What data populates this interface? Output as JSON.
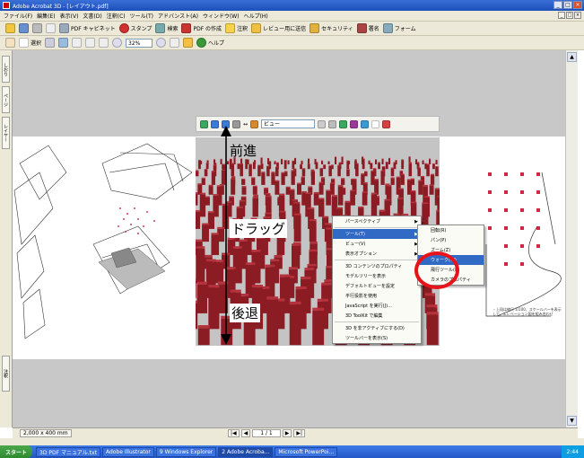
{
  "window": {
    "title": "Adobe Acrobat 3D - [レイアウト.pdf]",
    "min": "_",
    "max": "□",
    "close": "×"
  },
  "menubar": {
    "items": [
      "ファイル(F)",
      "編集(E)",
      "表示(V)",
      "文書(D)",
      "注釈(C)",
      "ツール(T)",
      "アドバンスト(A)",
      "ウィンドウ(W)",
      "ヘルプ(H)"
    ]
  },
  "toolbar1": {
    "pdf_cabinet": "PDF キャビネット",
    "sign": "スタンプ",
    "search": "検索",
    "pdf_create": "PDF の作成",
    "comment": "注釈",
    "review": "レビュー用に送信",
    "security": "セキュリティ",
    "sign2": "署名",
    "forms": "フォーム"
  },
  "toolbar2": {
    "select": "選択",
    "zoom": "32%",
    "help": "ヘルプ"
  },
  "left_tabs": [
    "しおり",
    "ページ",
    "レイヤー",
    "注釈"
  ],
  "viewer_toolbar": {
    "view_select": "ビュー"
  },
  "labels": {
    "forward": "前進",
    "drag": "ドラッグ",
    "back": "後退"
  },
  "context_menu": {
    "items": [
      {
        "label": "パースペクティブ",
        "has_sub": true
      },
      {
        "label": "ツール(T)",
        "has_sub": true,
        "highlight": true
      },
      {
        "label": "ビュー(V)",
        "has_sub": true
      },
      {
        "label": "表示オプション",
        "has_sub": true
      },
      {
        "label": "3D コンテンツのプロパティ",
        "has_sub": false
      },
      {
        "label": "モデルツリーを表示",
        "has_sub": false
      },
      {
        "label": "デフォルトビューを設定",
        "has_sub": false
      },
      {
        "label": "平行投影を使用",
        "has_sub": false
      },
      {
        "label": "JavaScript を実行(J)...",
        "has_sub": false
      },
      {
        "label": "3D ToolKit で編集",
        "has_sub": false
      },
      {
        "label": "3D を非アクティブにする(D)",
        "has_sub": false
      },
      {
        "label": "ツールバーを表示(S)",
        "has_sub": false
      }
    ]
  },
  "sub_menu": {
    "items": [
      {
        "label": "回転(R)",
        "highlight": false
      },
      {
        "label": "パン(P)",
        "highlight": false
      },
      {
        "label": "ズーム(Z)",
        "highlight": false
      },
      {
        "label": "ウォーク(W)",
        "highlight": true
      },
      {
        "label": "飛行ツール(F)",
        "highlight": false
      },
      {
        "label": "カメラのプロパティ",
        "highlight": false
      }
    ]
  },
  "status": {
    "page_size": "2,000 x 400 mm",
    "page_indicator": "1 / 1",
    "first": "|◀",
    "prev": "◀",
    "next": "▶",
    "last": "▶|"
  },
  "taskbar": {
    "start": "スタート",
    "items": [
      "3D PDF マニュアル.txt",
      "Adobe Illustrator",
      "9 Windows Explorer",
      "2 Adobe Acroba...",
      "Microsoft PowerPoi..."
    ],
    "active_index": 3,
    "clock": "2:44"
  },
  "notes": {
    "right_text": "・上段は縮尺 1/100、スケールバーを表示して、エレベーション図を組み合わせ"
  },
  "colors": {
    "highlight_ring": "#e8121b",
    "block_red": "#8b1c24"
  }
}
